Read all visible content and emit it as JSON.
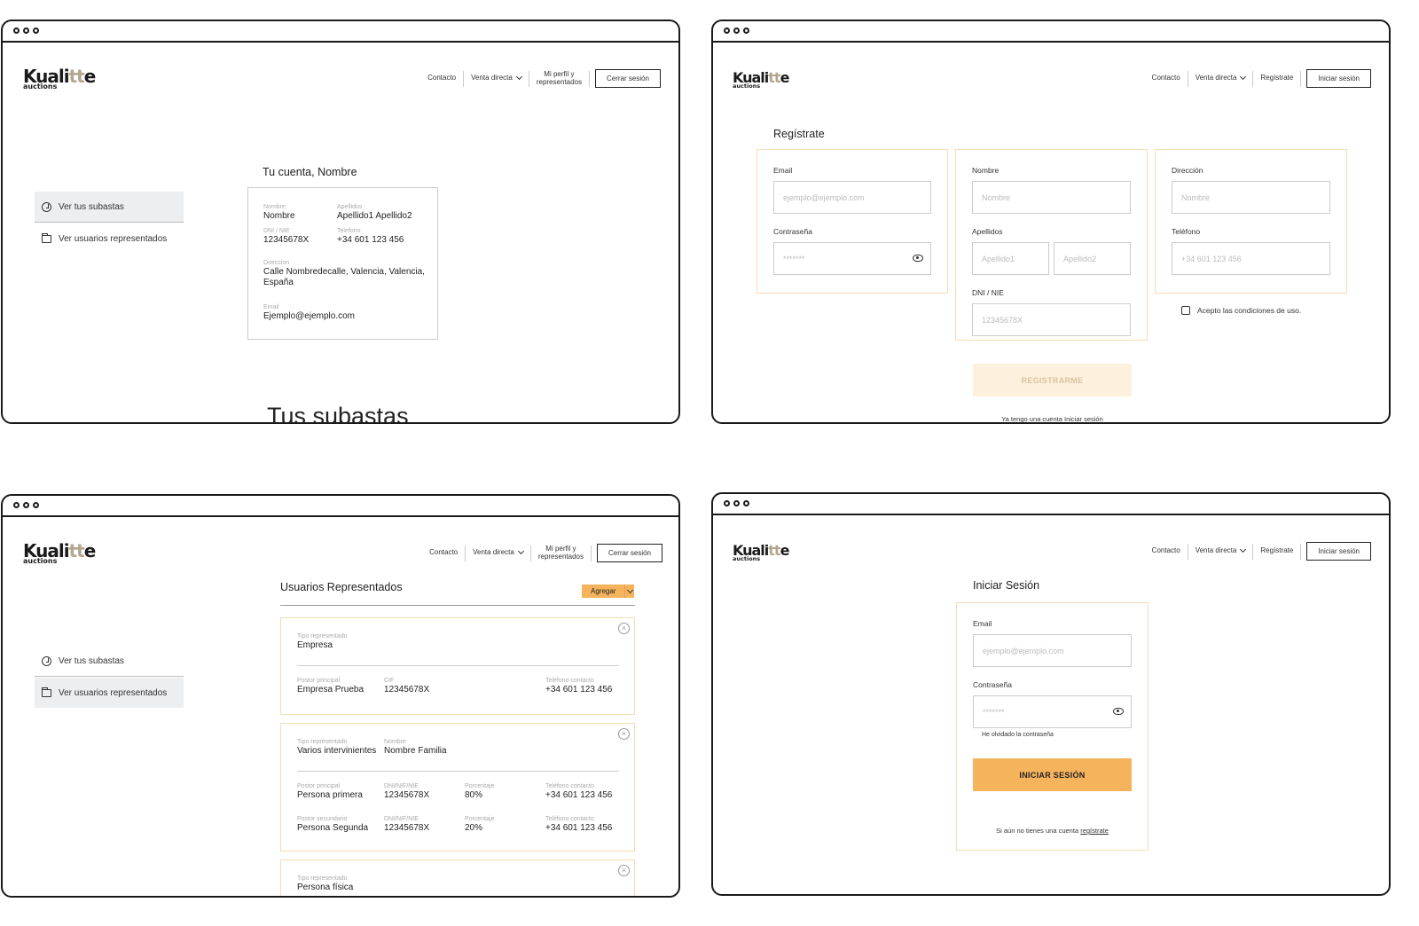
{
  "logo": {
    "main_a": "Kuali",
    "main_b": "tt",
    "main_c": "e",
    "sub": "auctions"
  },
  "nav": {
    "contacto": "Contacto",
    "venta_directa": "Venta directa",
    "mi_perfil_1": "Mi perfil y",
    "mi_perfil_2": "representados",
    "registrate": "Regístrate",
    "cerrar_sesion": "Cerrar sesión",
    "iniciar_sesion": "Iniciar sesión"
  },
  "sidebar": {
    "item_subastas": "Ver tus subastas",
    "item_usuarios": "Ver usuarios representados"
  },
  "account": {
    "title": "Tu cuenta, Nombre",
    "nombre_lbl": "Nombre",
    "nombre_val": "Nombre",
    "apellidos_lbl": "Apellidos",
    "apellidos_val": "Apellido1 Apellido2",
    "dni_lbl": "DNI / NIE",
    "dni_val": "12345678X",
    "tel_lbl": "Telefono",
    "tel_val": "+34 601 123 456",
    "dir_lbl": "Direccion",
    "dir_val_1": "Calle Nombredecalle, Valencia, Valencia,",
    "dir_val_2": "España",
    "email_lbl": "Email",
    "email_val": "Ejemplo@ejemplo.com",
    "subastas_heading": "Tus subastas"
  },
  "register": {
    "title": "Regístrate",
    "email_lbl": "Email",
    "email_ph": "ejemplo@ejemplo.com",
    "pass_lbl": "Contraseña",
    "pass_ph": "*******",
    "nombre_lbl": "Nombre",
    "nombre_ph": "Nombre",
    "apellidos_lbl": "Apellidos",
    "apellido1_ph": "Apellido1",
    "apellido2_ph": "Apellido2",
    "dni_lbl": "DNI / NIE",
    "dni_ph": "12345678X",
    "dir_lbl": "Dirección",
    "dir_ph": "Nombre",
    "tel_lbl": "Teléfono",
    "tel_ph": "+34 601 123 456",
    "accept": "Acepto las condiciones de uso.",
    "submit": "REGISTRARME",
    "have_account": "Ya tengo una cuenta",
    "login_link": "Iniciar sesión"
  },
  "representados": {
    "title": "Usuarios Representados",
    "agregar": "Agregar",
    "card1": {
      "tipo_lbl": "Tipo representado",
      "tipo_val": "Empresa",
      "postor_lbl": "Postor principal",
      "postor_val": "Empresa Prueba",
      "cif_lbl": "CIF",
      "cif_val": "12345678X",
      "tel_lbl": "Teléfono contacto",
      "tel_val": "+34 601 123 456"
    },
    "card2": {
      "tipo_lbl": "Tipo representado",
      "tipo_val": "Varios intervinientes",
      "nombre_lbl": "Nombre",
      "nombre_val": "Nombre Familia",
      "p1_lbl": "Postor principal",
      "p1_val": "Persona primera",
      "dni1_lbl": "DNI/NIF/NIE",
      "dni1_val": "12345678X",
      "pct1_lbl": "Porcentaje",
      "pct1_val": "80%",
      "tel1_lbl": "Teléfono contacto",
      "tel1_val": "+34 601 123 456",
      "p2_lbl": "Postor secundario",
      "p2_val": "Persona Segunda",
      "dni2_lbl": "DNI/NIF/NIE",
      "dni2_val": "12345678X",
      "pct2_lbl": "Porcentaje",
      "pct2_val": "20%",
      "tel2_lbl": "Teléfono contacto",
      "tel2_val": "+34 601 123 456"
    },
    "card3": {
      "tipo_lbl": "Tipo representado",
      "tipo_val": "Persona física"
    },
    "close_glyph": "×"
  },
  "login": {
    "title": "Iniciar Sesión",
    "email_lbl": "Email",
    "email_ph": "ejemplo@ejemplo.com",
    "pass_lbl": "Contraseña",
    "pass_ph": "*******",
    "forgot": "He olvidado la contraseña",
    "submit": "INICIAR SESIÓN",
    "no_account": "Si aún no tienes una cuenta",
    "register_link": "regístrate"
  },
  "colors": {
    "accent": "#f5b35c",
    "accent_light": "#fdf0dc",
    "border_accent": "#f6dcb3",
    "logo_tt": "#b3a58e"
  }
}
